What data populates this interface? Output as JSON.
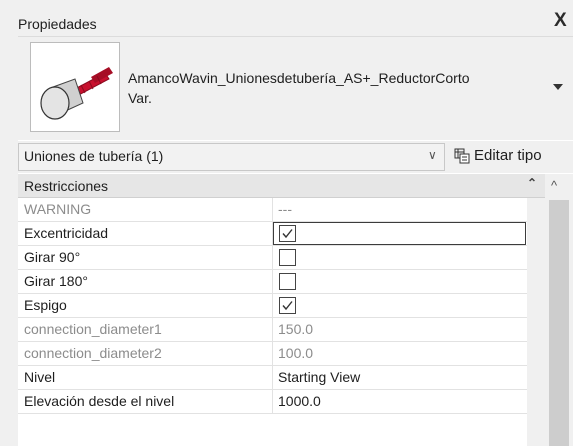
{
  "window": {
    "title": "Propiedades",
    "close_glyph": "X"
  },
  "type_selector": {
    "family_line1": "AmancoWavin_Unionesdetubería_AS+_ReductorCorto",
    "family_line2": "Var.",
    "thumbnail_icon": "pipe-reducer-thumbnail-icon"
  },
  "instance_filter": {
    "value": "Uniones de tubería (1)",
    "chevron": "∨",
    "edit_type_label": "Editar tipo"
  },
  "group": {
    "label": "Restricciones",
    "collapse_glyph": "⌃"
  },
  "scroll_up_glyph": "^",
  "properties": [
    {
      "name": "WARNING",
      "value": "---",
      "type": "text",
      "enabled": false
    },
    {
      "name": "Excentricidad",
      "value": "true",
      "type": "checkbox",
      "checked": true,
      "enabled": true,
      "selected": true
    },
    {
      "name": "Girar 90°",
      "value": "false",
      "type": "checkbox",
      "checked": false,
      "enabled": true
    },
    {
      "name": "Girar 180°",
      "value": "false",
      "type": "checkbox",
      "checked": false,
      "enabled": true
    },
    {
      "name": "Espigo",
      "value": "true",
      "type": "checkbox",
      "checked": true,
      "enabled": true
    },
    {
      "name": "connection_diameter1",
      "value": "150.0",
      "type": "text",
      "enabled": false
    },
    {
      "name": "connection_diameter2",
      "value": "100.0",
      "type": "text",
      "enabled": false
    },
    {
      "name": "Nivel",
      "value": "Starting View",
      "type": "text",
      "enabled": true
    },
    {
      "name": "Elevación desde el nivel",
      "value": "1000.0",
      "type": "text",
      "enabled": true
    }
  ],
  "colors": {
    "panel_bg": "#f0f0f0",
    "group_header_bg": "#e6e6e6",
    "disabled_text": "#8c8c8c",
    "thumbnail_red": "#c8102e"
  }
}
